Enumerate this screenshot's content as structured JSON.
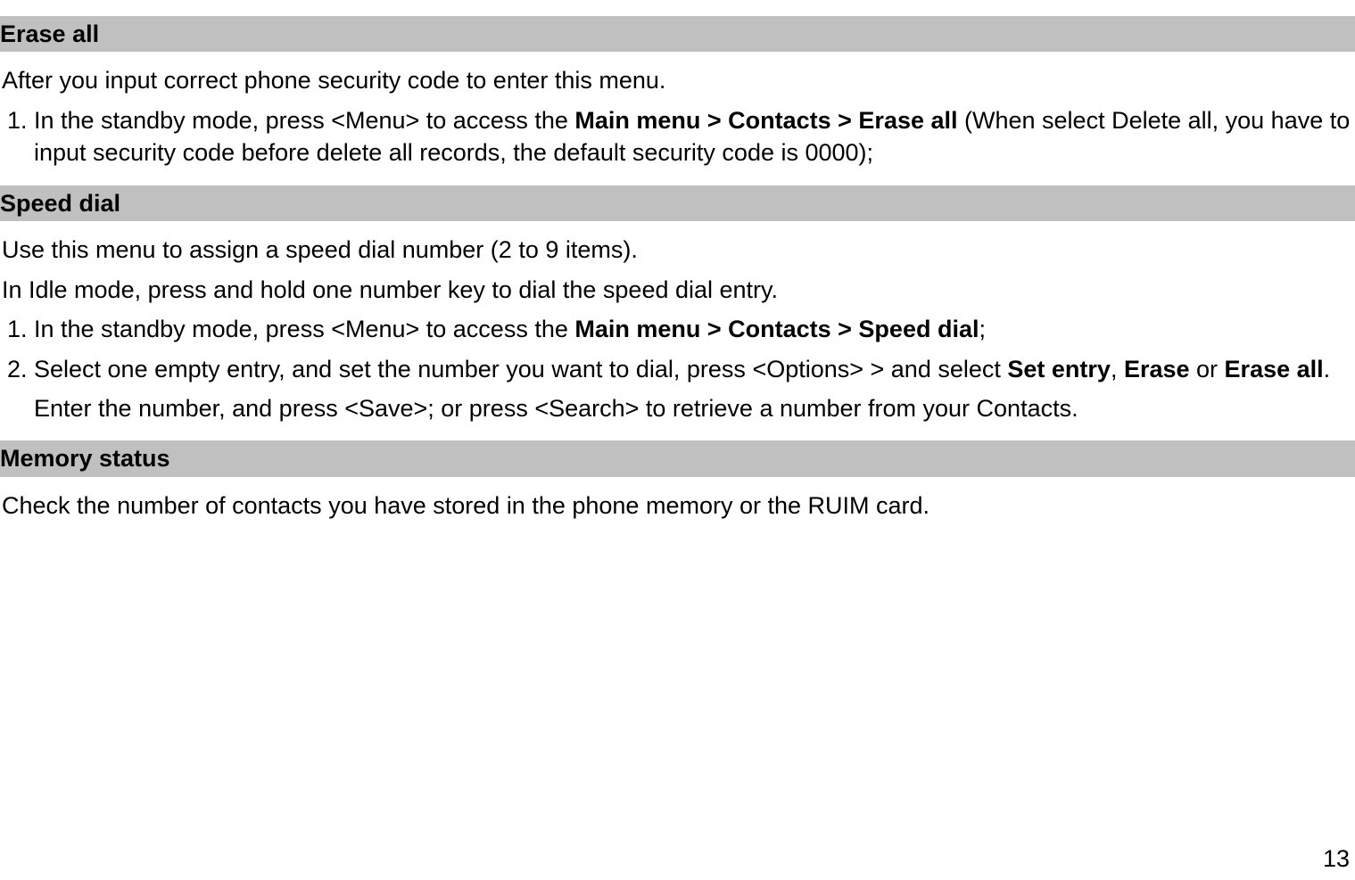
{
  "sections": {
    "erase_all": {
      "heading": "Erase all",
      "intro": "After you input correct phone security code to enter this menu.",
      "item1_pre": "In the standby mode, press <Menu> to access the ",
      "item1_bold": "Main menu > Contacts > Erase all",
      "item1_post": " (When select Delete all, you have to input security code before delete all records, the default security code is 0000);"
    },
    "speed_dial": {
      "heading": "Speed dial",
      "intro1": "Use this menu to assign a speed dial number (2 to 9 items).",
      "intro2": "In Idle mode, press and hold one number key to dial the speed dial entry.",
      "item1_pre": "In the standby mode, press <Menu> to access the ",
      "item1_bold": "Main menu > Contacts > Speed dial",
      "item1_post": ";",
      "item2_pre": "Select one empty entry, and set the number you want to dial, press <Options> > and select ",
      "item2_b1": "Set entry",
      "item2_sep1": ", ",
      "item2_b2": "Erase",
      "item2_sep2": " or ",
      "item2_b3": "Erase all",
      "item2_post": ".",
      "sub": "Enter the number, and press <Save>; or press <Search> to retrieve a number from your Contacts."
    },
    "memory_status": {
      "heading": "Memory status",
      "body": "Check the number of contacts you have stored in the phone memory or the RUIM card."
    }
  },
  "page_number": "13"
}
